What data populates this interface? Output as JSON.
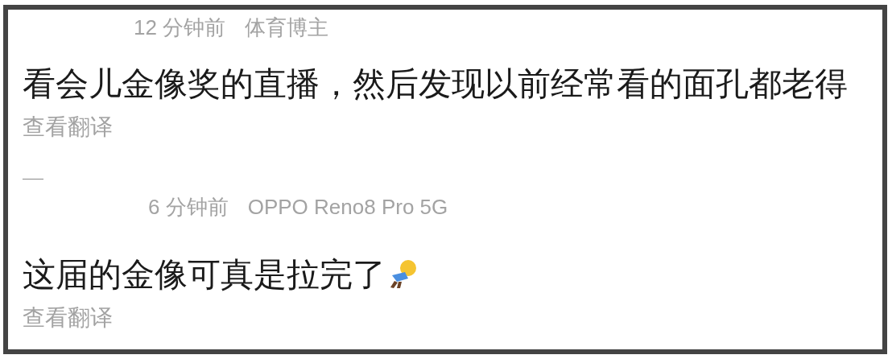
{
  "comments": [
    {
      "time": "12 分钟前",
      "source": "体育博主",
      "text": "看会儿金像奖的直播，然后发现以前经常看的面孔都老得",
      "translate": "查看翻译",
      "emoji": false,
      "divider": true
    },
    {
      "time": "6 分钟前",
      "source": "OPPO Reno8 Pro 5G",
      "text": "这届的金像可真是拉完了",
      "translate": "查看翻译",
      "emoji": true,
      "divider": false
    }
  ]
}
